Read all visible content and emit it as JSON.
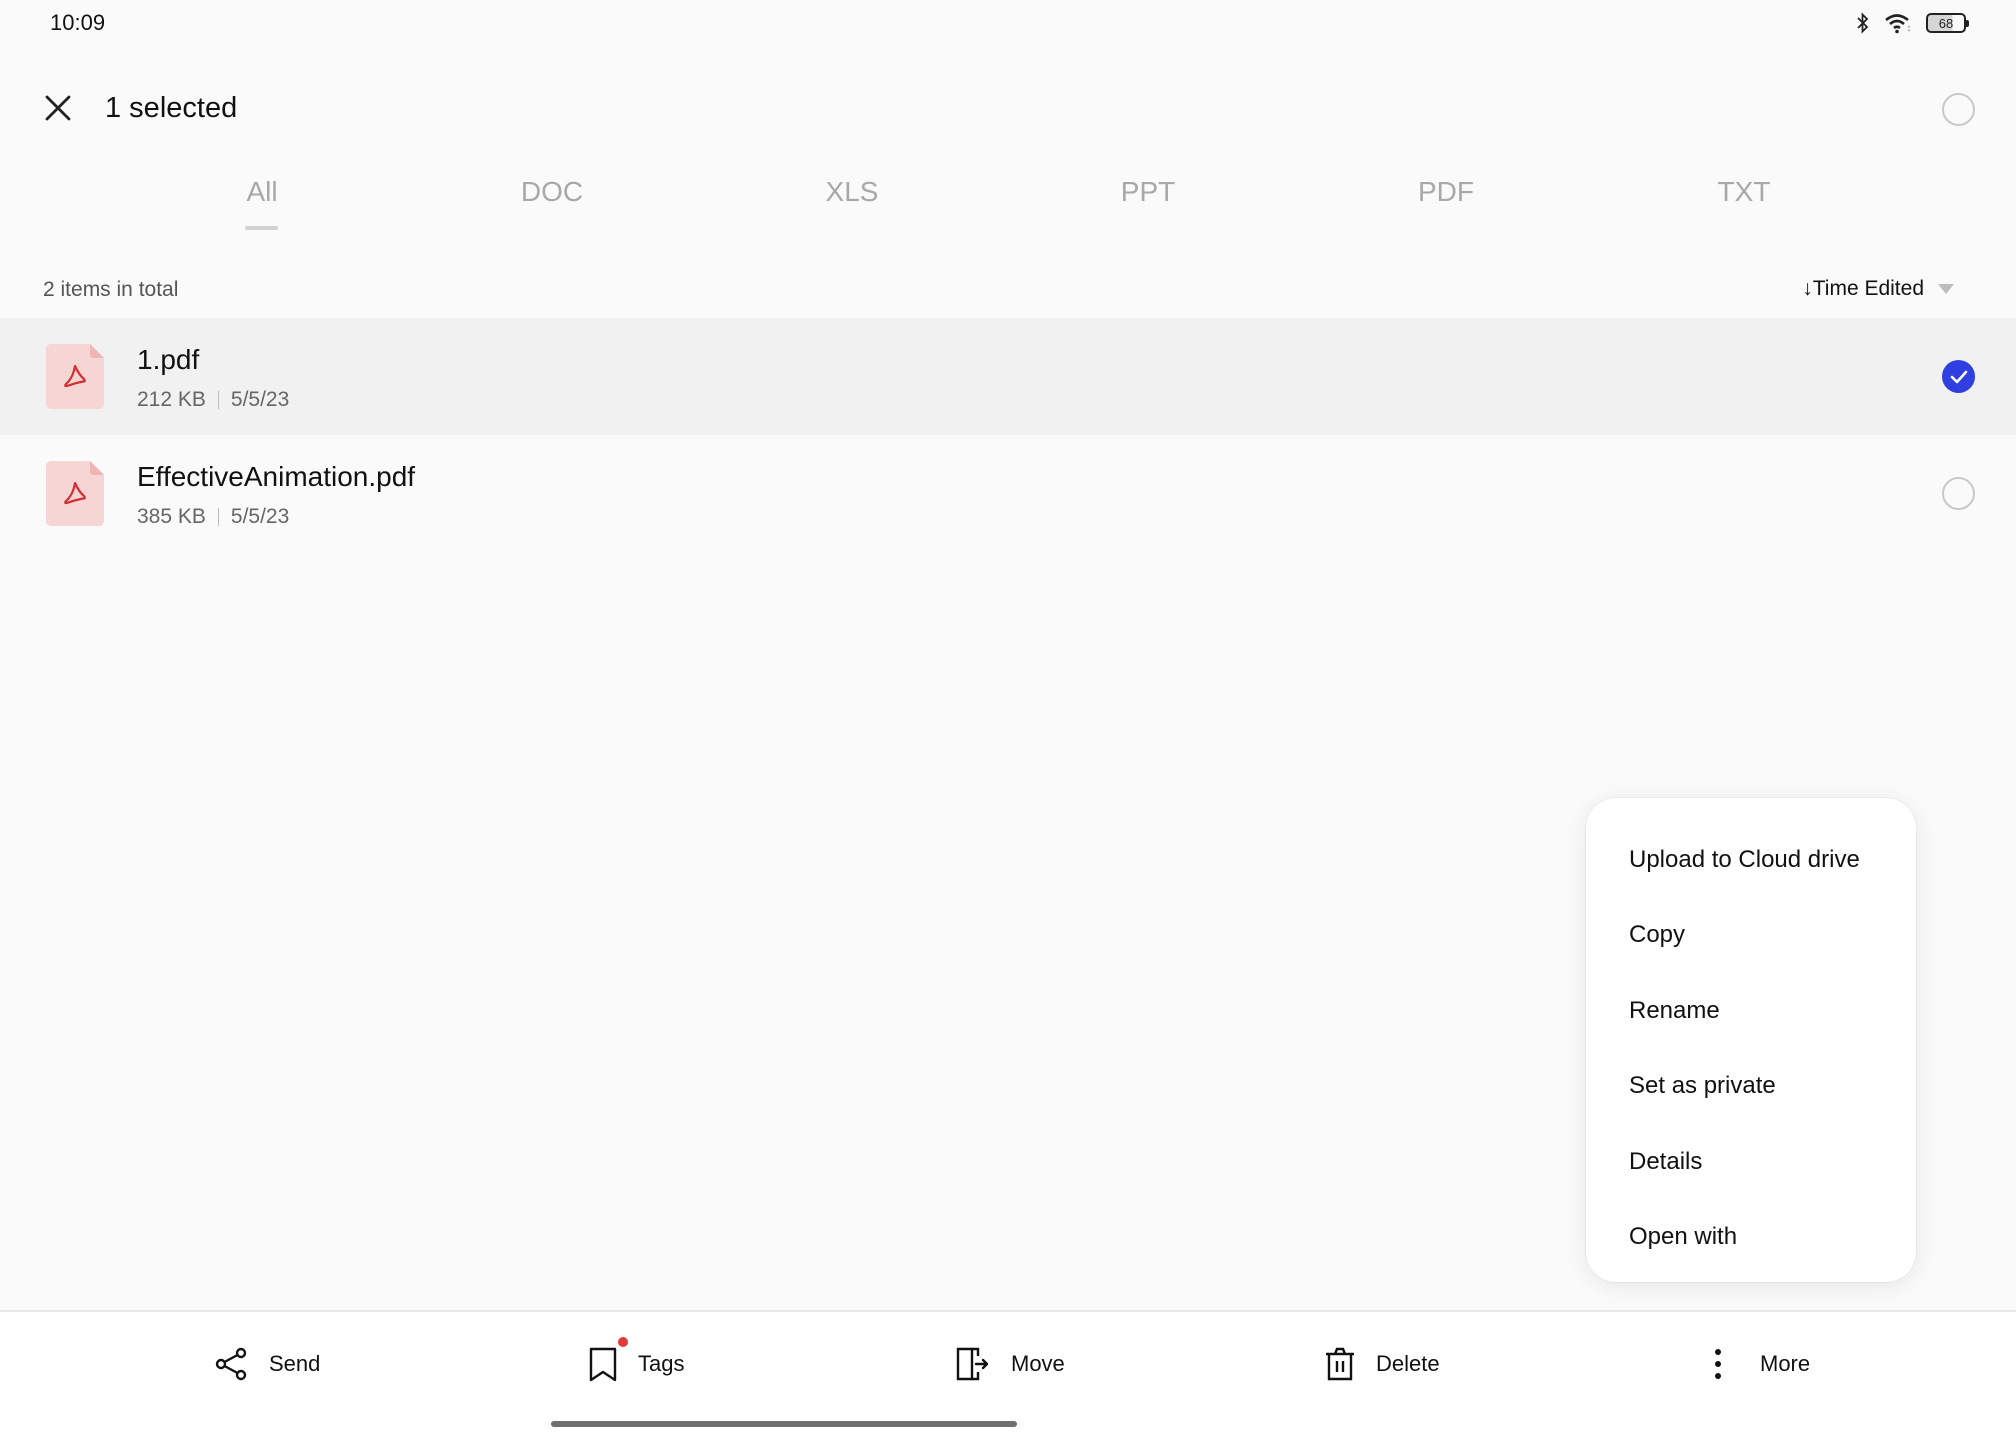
{
  "status_bar": {
    "time": "10:09",
    "icons": [
      "bluetooth-icon",
      "wifi-icon",
      "battery-icon"
    ],
    "battery_level": "68"
  },
  "header": {
    "close_icon": "close-icon",
    "title": "1 selected",
    "select_all_checked": false
  },
  "tabs": [
    {
      "label": "All",
      "active": true
    },
    {
      "label": "DOC",
      "active": false
    },
    {
      "label": "XLS",
      "active": false
    },
    {
      "label": "PPT",
      "active": false
    },
    {
      "label": "PDF",
      "active": false
    },
    {
      "label": "TXT",
      "active": false
    }
  ],
  "list": {
    "count_label": "2 items in total",
    "sort_label": "↓Time Edited",
    "files": [
      {
        "name": "1.pdf",
        "size": "212 KB",
        "date": "5/5/23",
        "type_icon": "pdf-file-icon",
        "selected": true
      },
      {
        "name": "EffectiveAnimation.pdf",
        "size": "385 KB",
        "date": "5/5/23",
        "type_icon": "pdf-file-icon",
        "selected": false
      }
    ]
  },
  "menu": {
    "items": [
      {
        "label": "Upload to Cloud drive"
      },
      {
        "label": "Copy"
      },
      {
        "label": "Rename"
      },
      {
        "label": "Set as private"
      },
      {
        "label": "Details"
      },
      {
        "label": "Open with"
      }
    ]
  },
  "bottom_bar": {
    "actions": [
      {
        "label": "Send",
        "icon": "share-icon"
      },
      {
        "label": "Tags",
        "icon": "bookmark-icon",
        "badge": true
      },
      {
        "label": "Move",
        "icon": "move-icon"
      },
      {
        "label": "Delete",
        "icon": "trash-icon"
      },
      {
        "label": "More",
        "icon": "more-vertical-icon"
      }
    ]
  },
  "colors": {
    "accent": "#2f3fe0",
    "pdf_icon_bg": "#f6d5d5",
    "pdf_icon_glyph": "#d32f2f",
    "badge": "#e53935",
    "selected_row_bg": "#f1f1f1"
  }
}
